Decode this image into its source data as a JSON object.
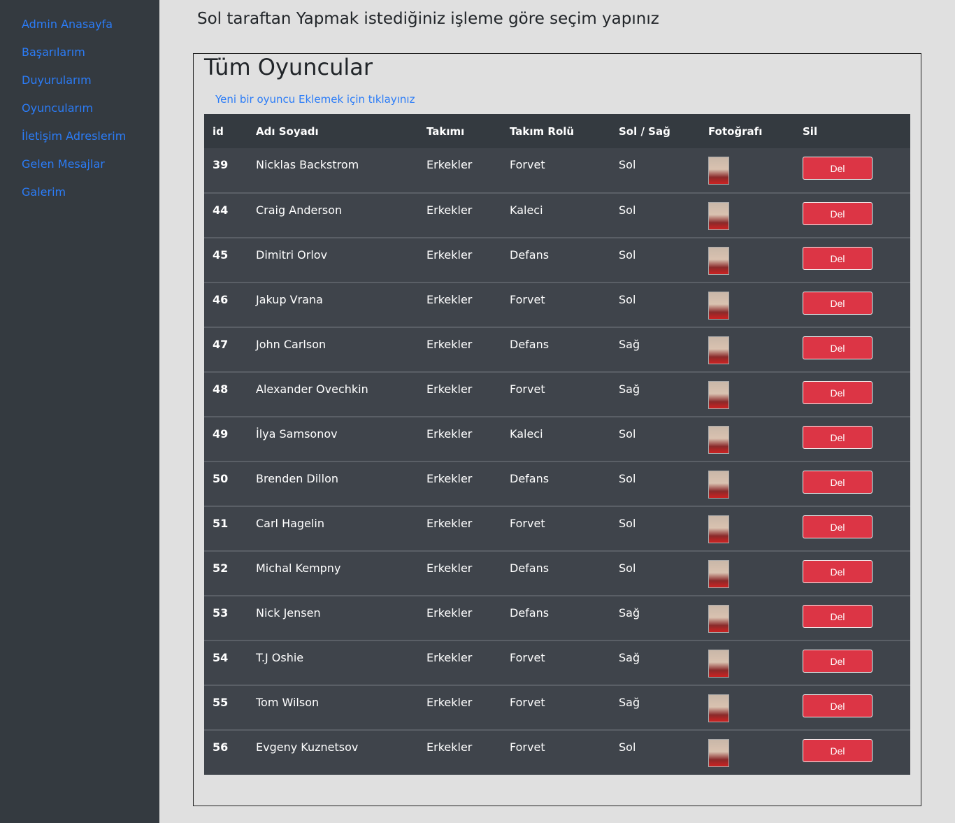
{
  "sidebar": {
    "items": [
      {
        "label": "Admin Anasayfa"
      },
      {
        "label": "Başarılarım"
      },
      {
        "label": "Duyurularım"
      },
      {
        "label": "Oyuncularım"
      },
      {
        "label": "İletişim Adreslerim"
      },
      {
        "label": "Gelen Mesajlar"
      },
      {
        "label": "Galerim"
      }
    ]
  },
  "header": {
    "instruction": "Sol taraftan Yapmak istediğiniz işleme göre seçim yapınız"
  },
  "panel": {
    "title": "Tüm Oyuncular",
    "add_link": "Yeni bir oyuncu Eklemek için tıklayınız"
  },
  "table": {
    "columns": [
      "id",
      "Adı Soyadı",
      "Takımı",
      "Takım Rolü",
      "Sol / Sağ",
      "Fotoğrafı",
      "Sil"
    ],
    "delete_label": "Del",
    "rows": [
      {
        "id": "39",
        "name": "Nicklas Backstrom",
        "team": "Erkekler",
        "role": "Forvet",
        "side": "Sol"
      },
      {
        "id": "44",
        "name": "Craig Anderson",
        "team": "Erkekler",
        "role": "Kaleci",
        "side": "Sol"
      },
      {
        "id": "45",
        "name": "Dimitri Orlov",
        "team": "Erkekler",
        "role": "Defans",
        "side": "Sol"
      },
      {
        "id": "46",
        "name": "Jakup Vrana",
        "team": "Erkekler",
        "role": "Forvet",
        "side": "Sol"
      },
      {
        "id": "47",
        "name": "John Carlson",
        "team": "Erkekler",
        "role": "Defans",
        "side": "Sağ"
      },
      {
        "id": "48",
        "name": "Alexander Ovechkin",
        "team": "Erkekler",
        "role": "Forvet",
        "side": "Sağ"
      },
      {
        "id": "49",
        "name": "İlya Samsonov",
        "team": "Erkekler",
        "role": "Kaleci",
        "side": "Sol"
      },
      {
        "id": "50",
        "name": "Brenden Dillon",
        "team": "Erkekler",
        "role": "Defans",
        "side": "Sol"
      },
      {
        "id": "51",
        "name": "Carl Hagelin",
        "team": "Erkekler",
        "role": "Forvet",
        "side": "Sol"
      },
      {
        "id": "52",
        "name": "Michal Kempny",
        "team": "Erkekler",
        "role": "Defans",
        "side": "Sol"
      },
      {
        "id": "53",
        "name": "Nick Jensen",
        "team": "Erkekler",
        "role": "Defans",
        "side": "Sağ"
      },
      {
        "id": "54",
        "name": "T.J Oshie",
        "team": "Erkekler",
        "role": "Forvet",
        "side": "Sağ"
      },
      {
        "id": "55",
        "name": "Tom Wilson",
        "team": "Erkekler",
        "role": "Forvet",
        "side": "Sağ"
      },
      {
        "id": "56",
        "name": "Evgeny Kuznetsov",
        "team": "Erkekler",
        "role": "Forvet",
        "side": "Sol"
      }
    ]
  }
}
